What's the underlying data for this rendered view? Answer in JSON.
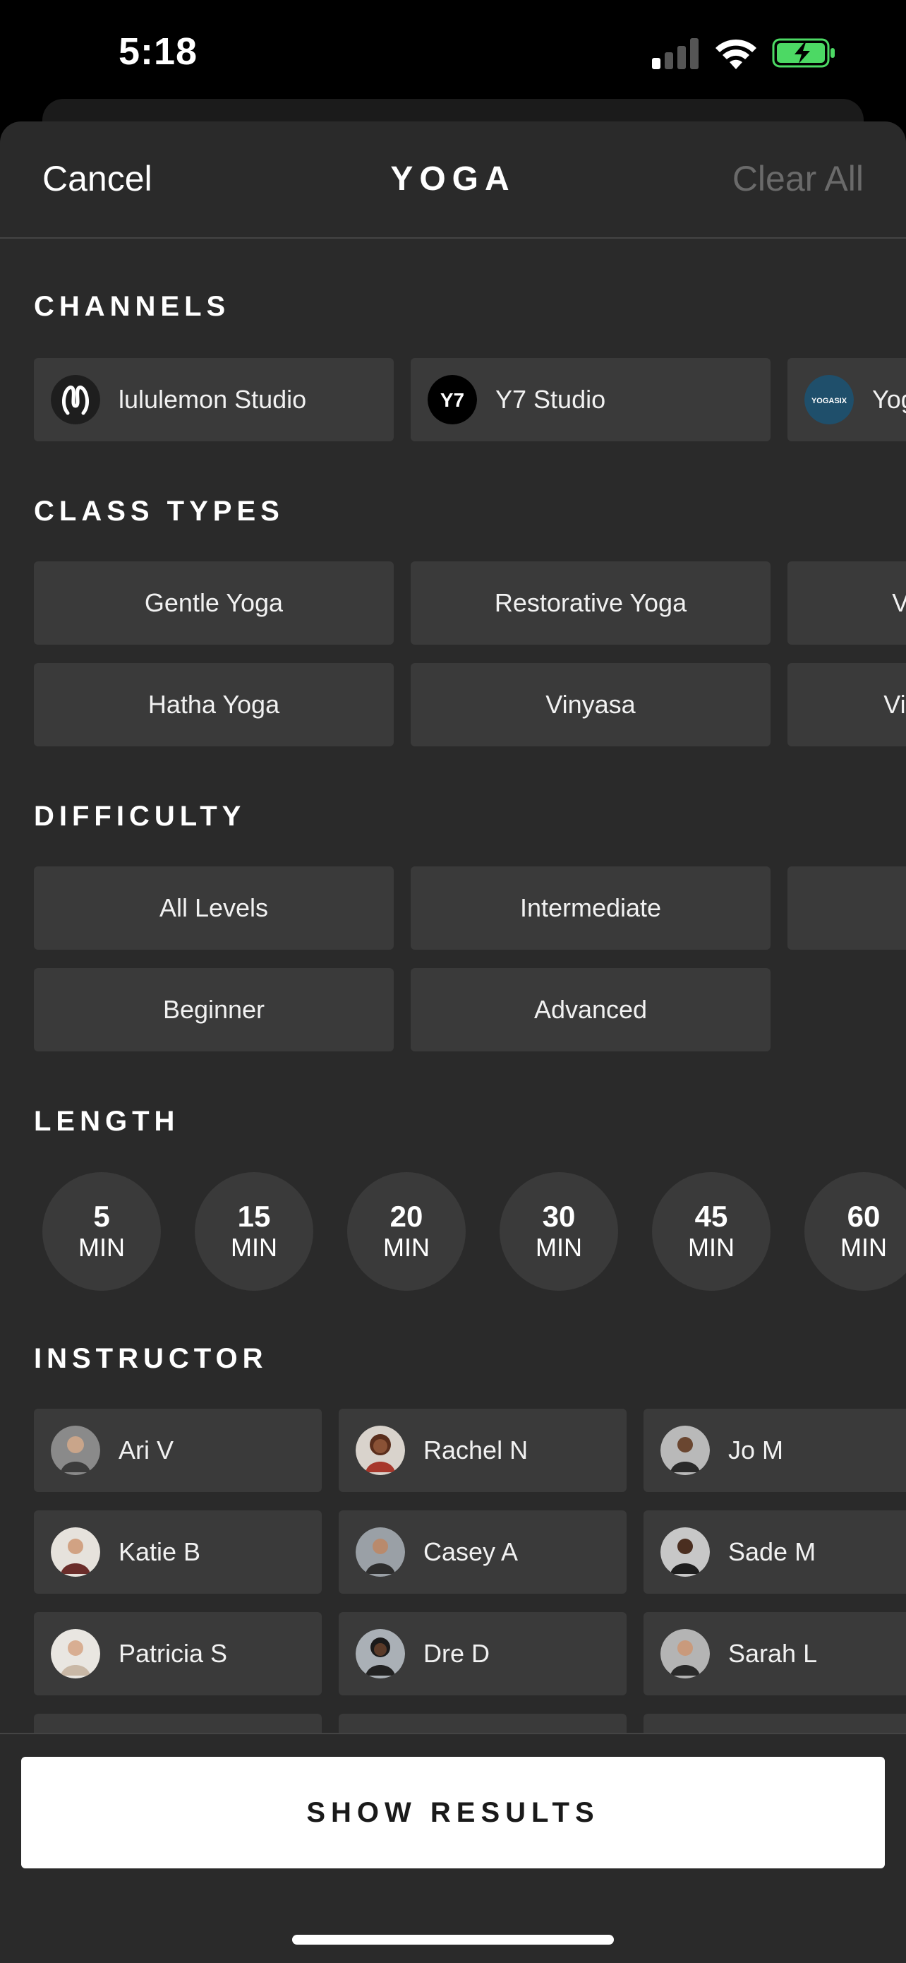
{
  "status": {
    "time": "5:18"
  },
  "header": {
    "cancel": "Cancel",
    "title": "YOGA",
    "clear_all": "Clear All"
  },
  "sections": {
    "channels": "CHANNELS",
    "class_types": "CLASS TYPES",
    "difficulty": "DIFFICULTY",
    "length": "LENGTH",
    "instructor": "INSTRUCTOR"
  },
  "channels": [
    {
      "label": "lululemon Studio",
      "logo": "lululemon-logo"
    },
    {
      "label": "Y7 Studio",
      "logo": "Y7"
    },
    {
      "label": "YogaSix",
      "logo": "YOGASIX"
    }
  ],
  "class_types": [
    "Gentle Yoga",
    "Restorative Yoga",
    "Vinyasa Flow",
    "Hatha Yoga",
    "Vinyasa",
    "Vinyasa Sculpt"
  ],
  "difficulty": [
    "All Levels",
    "Intermediate",
    "",
    "Beginner",
    "Advanced"
  ],
  "length": [
    {
      "n": "5",
      "u": "MIN"
    },
    {
      "n": "15",
      "u": "MIN"
    },
    {
      "n": "20",
      "u": "MIN"
    },
    {
      "n": "30",
      "u": "MIN"
    },
    {
      "n": "45",
      "u": "MIN"
    },
    {
      "n": "60",
      "u": "MIN"
    }
  ],
  "instructors": [
    "Ari V",
    "Rachel N",
    "Jo M",
    "Katie B",
    "Casey A",
    "Sade M",
    "Patricia S",
    "Dre D",
    "Sarah L"
  ],
  "footer": {
    "show_results": "SHOW RESULTS"
  },
  "colors": {
    "sheet": "#2a2a2a",
    "chip": "#3a3a3a",
    "accent_battery": "#4cd964"
  }
}
